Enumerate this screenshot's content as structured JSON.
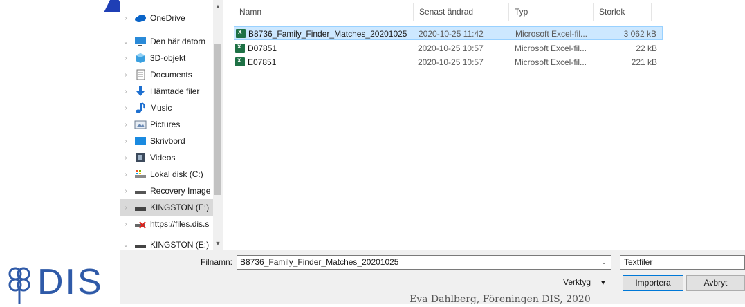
{
  "nav": {
    "items": [
      {
        "label": "OneDrive",
        "icon": "cloud-icon"
      },
      {
        "label": "Den här datorn",
        "icon": "computer-icon"
      },
      {
        "label": "3D-objekt",
        "icon": "cube-icon"
      },
      {
        "label": "Documents",
        "icon": "document-icon"
      },
      {
        "label": "Hämtade filer",
        "icon": "download-arrow-icon"
      },
      {
        "label": "Music",
        "icon": "music-note-icon"
      },
      {
        "label": "Pictures",
        "icon": "picture-icon"
      },
      {
        "label": "Skrivbord",
        "icon": "desktop-icon"
      },
      {
        "label": "Videos",
        "icon": "film-icon"
      },
      {
        "label": "Lokal disk (C:)",
        "icon": "hard-drive-icon"
      },
      {
        "label": "Recovery Image",
        "icon": "drive-icon"
      },
      {
        "label": "KINGSTON (E:)",
        "icon": "usb-drive-icon"
      },
      {
        "label": "https://files.dis.s",
        "icon": "network-drive-disconnected-icon"
      },
      {
        "label": "KINGSTON (E:)",
        "icon": "usb-drive-icon"
      }
    ]
  },
  "columns": {
    "name": "Namn",
    "date": "Senast ändrad",
    "type": "Typ",
    "size": "Storlek"
  },
  "files": [
    {
      "name": "B8736_Family_Finder_Matches_20201025",
      "date": "2020-10-25 11:42",
      "type": "Microsoft Excel-fil...",
      "size": "3 062 kB"
    },
    {
      "name": "D07851",
      "date": "2020-10-25 10:57",
      "type": "Microsoft Excel-fil...",
      "size": "22 kB"
    },
    {
      "name": "E07851",
      "date": "2020-10-25 10:57",
      "type": "Microsoft Excel-fil...",
      "size": "221 kB"
    }
  ],
  "bottom": {
    "filename_label": "Filnamn:",
    "filename_value": "B8736_Family_Finder_Matches_20201025",
    "filter_value": "Textfiler",
    "tools_label": "Verktyg",
    "import_label": "Importera",
    "cancel_label": "Avbryt"
  },
  "slide": {
    "logo_text": "DIS",
    "footer": "Eva Dahlberg, Föreningen DIS, 2020"
  },
  "colors": {
    "selection": "#cde8ff",
    "accent": "#0078d7",
    "excel": "#1e7145",
    "logo": "#2f5aa8"
  }
}
